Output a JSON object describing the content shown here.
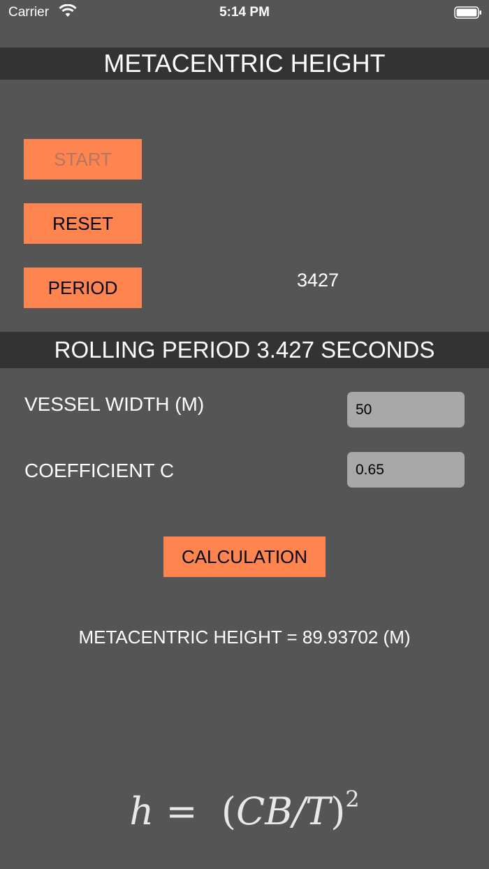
{
  "status_bar": {
    "carrier": "Carrier",
    "time": "5:14 PM"
  },
  "header": {
    "title": "METACENTRIC HEIGHT"
  },
  "timer": {
    "start_label": "START",
    "reset_label": "RESET",
    "period_label": "PERIOD",
    "period_value": "3427"
  },
  "period_band": {
    "text": "ROLLING PERIOD 3.427 SECONDS"
  },
  "inputs": {
    "vessel_width_label": "VESSEL WIDTH (M)",
    "vessel_width_value": "50",
    "coefficient_label": "COEFFICIENT C",
    "coefficient_value": "0.65"
  },
  "actions": {
    "calculation_label": "CALCULATION"
  },
  "result": {
    "text": "METACENTRIC HEIGHT = 89.93702 (M)"
  },
  "formula": {
    "lhs": "h",
    "eq": "=",
    "open": "(",
    "body": "CB/T",
    "close": ")",
    "exponent": "2"
  },
  "colors": {
    "background": "#555555",
    "band": "#333333",
    "button": "#ff8550",
    "field": "#a8a8a8"
  },
  "icons": [
    "wifi-icon",
    "battery-icon"
  ]
}
